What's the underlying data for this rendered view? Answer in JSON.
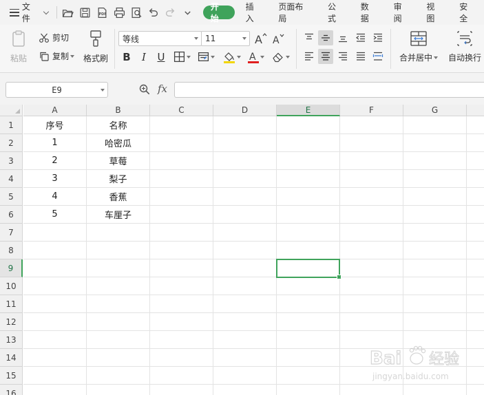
{
  "menubar": {
    "file_label": "文件",
    "tabs": [
      "开始",
      "插入",
      "页面布局",
      "公式",
      "数据",
      "审阅",
      "视图",
      "安全"
    ]
  },
  "ribbon": {
    "paste_label": "粘贴",
    "cut_label": "剪切",
    "copy_label": "复制",
    "format_painter_label": "格式刷",
    "font_name": "等线",
    "font_size": "11",
    "bold": "B",
    "italic": "I",
    "underline": "U",
    "merge_center_label": "合并居中",
    "wrap_text_label": "自动换行"
  },
  "formula_bar": {
    "name_box": "E9",
    "fx_label": "fx",
    "formula": ""
  },
  "sheet": {
    "columns": [
      "A",
      "B",
      "C",
      "D",
      "E",
      "F",
      "G"
    ],
    "rows": [
      "1",
      "2",
      "3",
      "4",
      "5",
      "6",
      "7",
      "8",
      "9",
      "10",
      "11",
      "12",
      "13",
      "14",
      "15",
      "16"
    ],
    "selected_cell": "E9",
    "data": [
      [
        "序号",
        "名称"
      ],
      [
        "1",
        "哈密瓜"
      ],
      [
        "2",
        "草莓"
      ],
      [
        "3",
        "梨子"
      ],
      [
        "4",
        "香蕉"
      ],
      [
        "5",
        "车厘子"
      ]
    ]
  },
  "colors": {
    "accent": "#3fa35b",
    "grid_line": "#e3e3e3"
  }
}
